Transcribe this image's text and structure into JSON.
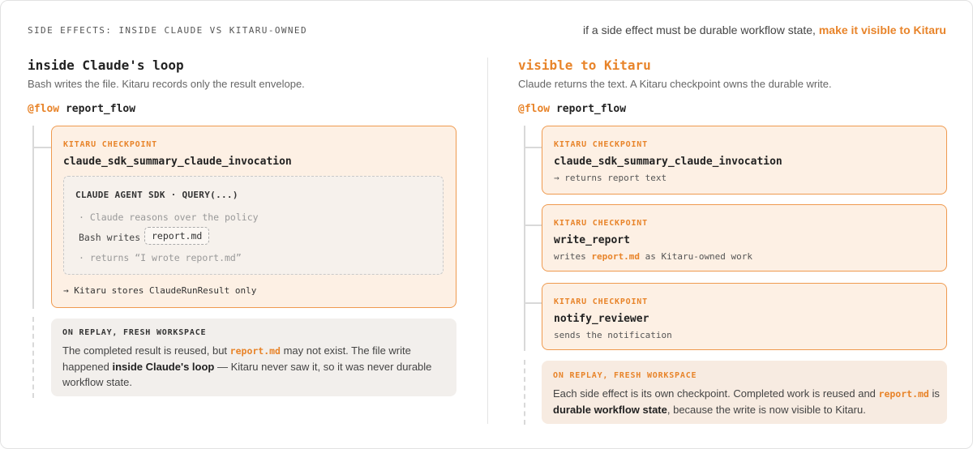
{
  "header": {
    "title": "SIDE EFFECTS: INSIDE CLAUDE VS KITARU-OWNED",
    "tagline_plain": "if a side effect must be durable workflow state,",
    "tagline_accent": "make it visible to Kitaru"
  },
  "left": {
    "title": "inside Claude's loop",
    "subtitle": "Bash writes the file. Kitaru records only the result envelope.",
    "flow_decorator": "@flow",
    "flow_name": "report_flow",
    "checkpoint": {
      "tag": "KITARU CHECKPOINT",
      "name": "claude_sdk_summary_claude_invocation",
      "sdk": {
        "title": "CLAUDE AGENT SDK · QUERY(...)",
        "line1": "· Claude reasons over the policy",
        "bash_label": "Bash writes",
        "file": "report.md",
        "line3": "· returns “I wrote report.md”"
      },
      "result": "→ Kitaru stores ClaudeRunResult only"
    },
    "replay": {
      "tag": "ON REPLAY, FRESH WORKSPACE",
      "t1": "The completed result is reused, but ",
      "code": "report.md",
      "t2": " may not exist. The file write happened ",
      "bold": "inside Claude's loop",
      "t3": " — Kitaru never saw it, so it was never durable workflow state."
    }
  },
  "right": {
    "title": "visible to Kitaru",
    "subtitle": "Claude returns the text. A Kitaru checkpoint owns the durable write.",
    "flow_decorator": "@flow",
    "flow_name": "report_flow",
    "checkpoints": [
      {
        "tag": "KITARU CHECKPOINT",
        "name": "claude_sdk_summary_claude_invocation",
        "note_pre": "→ returns report text",
        "note_code": "",
        "note_post": ""
      },
      {
        "tag": "KITARU CHECKPOINT",
        "name": "write_report",
        "note_pre": "writes ",
        "note_code": "report.md",
        "note_post": " as Kitaru-owned work"
      },
      {
        "tag": "KITARU CHECKPOINT",
        "name": "notify_reviewer",
        "note_pre": "sends the notification",
        "note_code": "",
        "note_post": ""
      }
    ],
    "replay": {
      "tag": "ON REPLAY, FRESH WORKSPACE",
      "t1": "Each side effect is its own checkpoint. Completed work is reused and ",
      "code": "report.md",
      "t2": " is ",
      "bold": "durable workflow state",
      "t3": ", because the write is now visible to Kitaru."
    }
  },
  "colors": {
    "accent": "#e8842a",
    "checkpoint_bg": "#fdf0e4",
    "checkpoint_border": "#ef9a4f",
    "replay_left_bg": "#f2efec",
    "replay_right_bg": "#f7ebe1"
  }
}
